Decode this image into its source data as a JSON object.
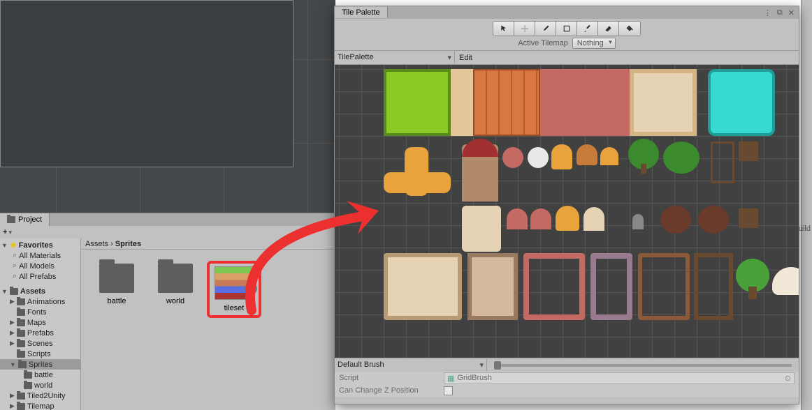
{
  "scene": {},
  "project": {
    "tab_label": "Project",
    "toolbar_plus": "+",
    "favorites_label": "Favorites",
    "fav_items": [
      "All Materials",
      "All Models",
      "All Prefabs"
    ],
    "assets_label": "Assets",
    "tree": [
      {
        "label": "Animations"
      },
      {
        "label": "Fonts"
      },
      {
        "label": "Maps"
      },
      {
        "label": "Prefabs"
      },
      {
        "label": "Scenes"
      },
      {
        "label": "Scripts"
      },
      {
        "label": "Sprites",
        "selected": true,
        "children": [
          {
            "label": "battle"
          },
          {
            "label": "world"
          }
        ]
      },
      {
        "label": "Tiled2Unity"
      },
      {
        "label": "Tilemap"
      }
    ],
    "breadcrumb_root": "Assets",
    "breadcrumb_sep": "›",
    "breadcrumb_current": "Sprites",
    "grid_items": [
      {
        "name": "battle",
        "type": "folder"
      },
      {
        "name": "world",
        "type": "folder"
      },
      {
        "name": "tileset",
        "type": "image",
        "highlight": true
      }
    ]
  },
  "palette": {
    "tab_label": "Tile Palette",
    "tools": [
      "select",
      "move",
      "brush",
      "box",
      "picker",
      "eraser",
      "fill"
    ],
    "active_tilemap_label": "Active Tilemap",
    "active_tilemap_value": "Nothing",
    "palette_dropdown": "TilePalette",
    "edit_label": "Edit",
    "brush_dropdown": "Default Brush",
    "script_label": "Script",
    "script_value": "GridBrush",
    "zpos_label": "Can Change Z Position",
    "zpos_checked": false
  },
  "right_panel_hint": "uild"
}
